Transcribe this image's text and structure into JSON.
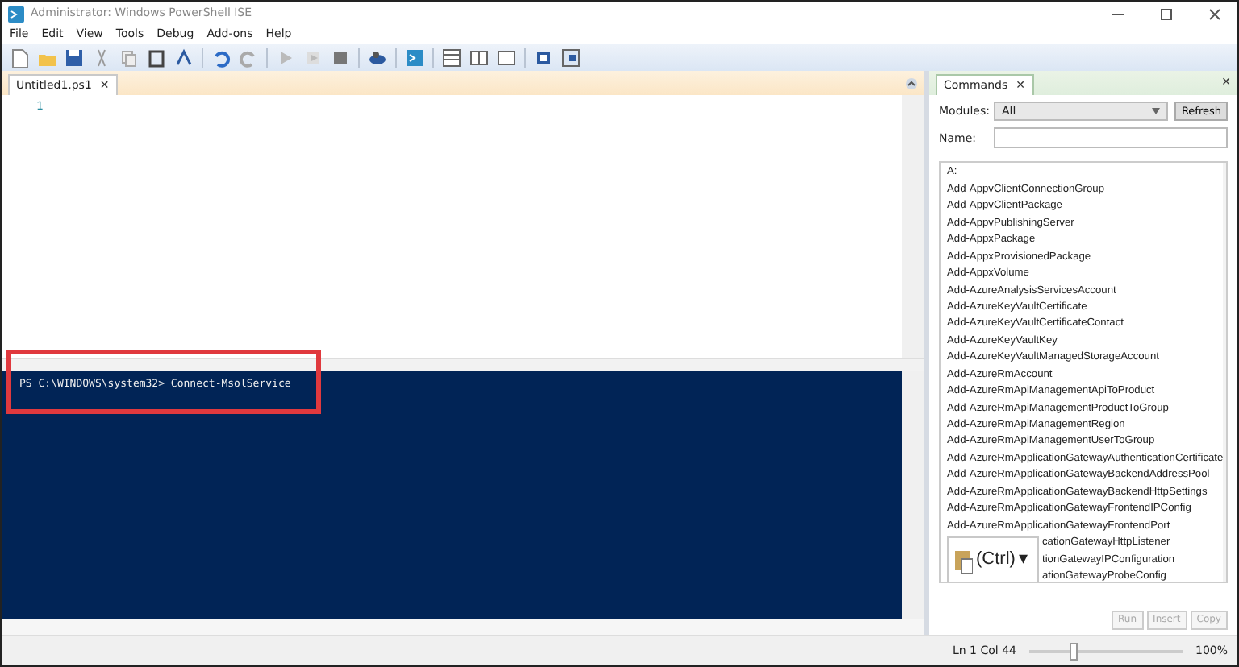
{
  "window": {
    "title": "Administrator: Windows PowerShell ISE"
  },
  "menu": [
    "File",
    "Edit",
    "View",
    "Tools",
    "Debug",
    "Add-ons",
    "Help"
  ],
  "tabs": [
    {
      "label": "Untitled1.ps1",
      "selected": true,
      "close": "✕"
    }
  ],
  "editor": {
    "line_numbers": [
      "1"
    ]
  },
  "console": {
    "lines": [
      "PS C:\\WINDOWS\\system32> Connect-MsolService"
    ],
    "highlighted": true
  },
  "commands_pane": {
    "tab": {
      "label": "Commands",
      "selected": true,
      "close": "✕"
    },
    "pane_close": "✕",
    "modules_label": "Modules:",
    "modules_value": "All",
    "refresh": "Refresh",
    "name_label": "Name:",
    "items": [
      "A:",
      "Add-AppvClientConnectionGroup",
      "Add-AppvClientPackage",
      "Add-AppvPublishingServer",
      "Add-AppxPackage",
      "Add-AppxProvisionedPackage",
      "Add-AppxVolume",
      "Add-AzureAnalysisServicesAccount",
      "Add-AzureKeyVaultCertificate",
      "Add-AzureKeyVaultCertificateContact",
      "Add-AzureKeyVaultKey",
      "Add-AzureKeyVaultManagedStorageAccount",
      "Add-AzureRmAccount",
      "Add-AzureRmApiManagementApiToProduct",
      "Add-AzureRmApiManagementProductToGroup",
      "Add-AzureRmApiManagementRegion",
      "Add-AzureRmApiManagementUserToGroup",
      "Add-AzureRmApplicationGatewayAuthenticationCertificate",
      "Add-AzureRmApplicationGatewayBackendAddressPool",
      "Add-AzureRmApplicationGatewayBackendHttpSettings",
      "Add-AzureRmApplicationGatewayFrontendIPConfig",
      "Add-AzureRmApplicationGatewayFrontendPort"
    ],
    "items_beside_popup": [
      "cationGatewayHttpListener",
      "tionGatewayIPConfiguration",
      "ationGatewayProbeConfig"
    ],
    "buttons": [
      {
        "label": "Run",
        "disabled": true
      },
      {
        "label": "Insert",
        "disabled": true
      },
      {
        "label": "Copy",
        "disabled": true
      }
    ]
  },
  "paste_popup": {
    "label": "(Ctrl)",
    "caret": "▾"
  },
  "status_bar": {
    "position": "Ln 1  Col 44",
    "zoom_slider": {
      "level": 0.3
    },
    "zoom": "100%"
  }
}
